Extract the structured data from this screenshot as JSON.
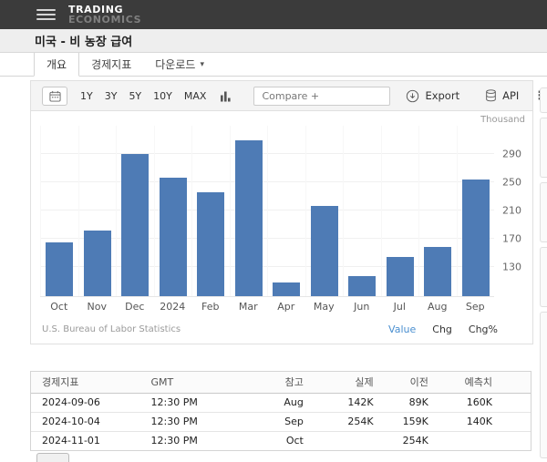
{
  "header": {
    "brand_line1": "TRADING",
    "brand_line2": "ECONOMICS"
  },
  "page": {
    "title": "미국 - 비 농장 급여"
  },
  "tabs": [
    {
      "label": "개요",
      "active": true
    },
    {
      "label": "경제지표",
      "active": false
    },
    {
      "label": "다운로드",
      "active": false
    }
  ],
  "icons": {
    "caret": "▾",
    "kebab": "⋮"
  },
  "toolbar": {
    "ranges": [
      "1Y",
      "3Y",
      "5Y",
      "10Y",
      "MAX"
    ],
    "compare_placeholder": "Compare +",
    "export_label": "Export",
    "api_label": "API"
  },
  "chart_data": {
    "type": "bar",
    "title": "미국 - 비 농장 급여",
    "unit": "Thousand",
    "categories": [
      "Oct",
      "Nov",
      "Dec",
      "2024",
      "Feb",
      "Mar",
      "Apr",
      "May",
      "Jun",
      "Jul",
      "Aug",
      "Sep"
    ],
    "values": [
      165,
      182,
      290,
      256,
      236,
      310,
      108,
      216,
      118,
      144,
      159,
      254
    ],
    "yticks": [
      130,
      170,
      210,
      250,
      290
    ],
    "ylim": [
      89,
      330
    ],
    "grid": "on",
    "legend": "off",
    "bar_color": "#4e7bb5",
    "source": "U.S. Bureau of Labor Statistics",
    "links": [
      "Value",
      "Chg",
      "Chg%"
    ],
    "active_link": "Value"
  },
  "colors": {
    "accent_blue": "#4a8fd0",
    "bar": "#4e7bb5",
    "topbar": "#3b3b3b"
  },
  "table": {
    "headers": [
      "경제지표",
      "GMT",
      "참고",
      "실제",
      "이전",
      "예측치"
    ],
    "rows": [
      [
        "2024-09-06",
        "12:30 PM",
        "Aug",
        "142K",
        "89K",
        "160K"
      ],
      [
        "2024-10-04",
        "12:30 PM",
        "Sep",
        "254K",
        "159K",
        "140K"
      ],
      [
        "2024-11-01",
        "12:30 PM",
        "Oct",
        "",
        "254K",
        ""
      ]
    ]
  }
}
